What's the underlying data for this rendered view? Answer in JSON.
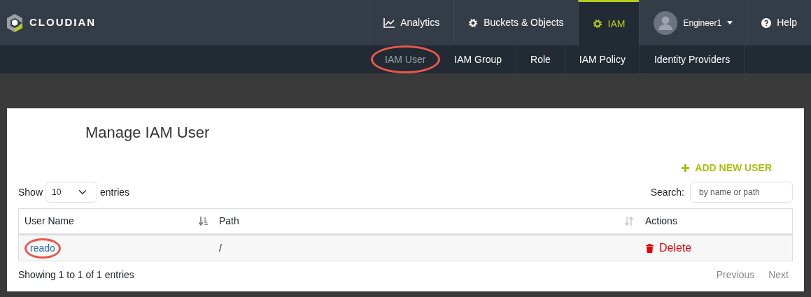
{
  "brand": {
    "name": "CLOUDIAN"
  },
  "nav": [
    {
      "label": "Analytics",
      "kind": "chart",
      "selected": false
    },
    {
      "label": "Buckets & Objects",
      "kind": "gear",
      "selected": false
    },
    {
      "label": "IAM",
      "kind": "gear",
      "selected": true
    }
  ],
  "user_menu": {
    "label": "Engineer1"
  },
  "help": {
    "label": "Help"
  },
  "subnav": [
    {
      "label": "IAM User",
      "selected": true,
      "circled": true
    },
    {
      "label": "IAM Group",
      "selected": false,
      "circled": false
    },
    {
      "label": "Role",
      "selected": false,
      "circled": false
    },
    {
      "label": "IAM Policy",
      "selected": false,
      "circled": false
    },
    {
      "label": "Identity Providers",
      "selected": false,
      "circled": false
    }
  ],
  "page": {
    "title": "Manage IAM User",
    "add_button": "ADD NEW USER"
  },
  "length": {
    "prefix": "Show",
    "value": "10",
    "suffix": "entries"
  },
  "search": {
    "label": "Search:",
    "placeholder": "by name or path"
  },
  "table": {
    "columns": [
      {
        "label": "User Name",
        "sorted": true
      },
      {
        "label": "Path",
        "sortable": true,
        "sorted": false
      },
      {
        "label": "Actions",
        "sortable": false,
        "sorted": false
      }
    ],
    "rows": [
      {
        "user_name": "reado",
        "circled": true,
        "path": "/",
        "action": "Delete"
      }
    ]
  },
  "info": "Showing 1 to 1 of 1 entries",
  "pagination": [
    {
      "label": "Previous",
      "disabled": true
    },
    {
      "label": "Next",
      "disabled": true
    }
  ]
}
